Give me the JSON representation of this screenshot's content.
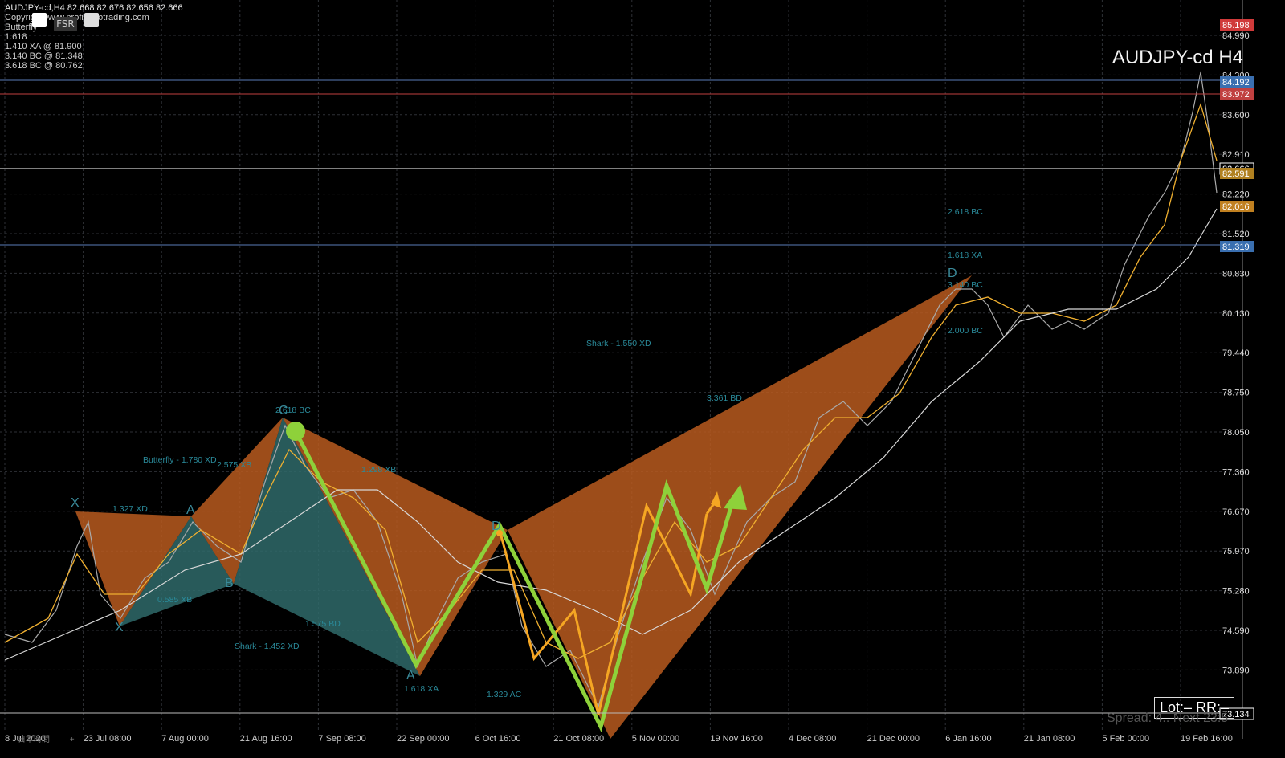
{
  "header": {
    "symbol_line": "AUDJPY-cd,H4  82.668 82.676 82.656 82.666",
    "copyright": "Copyright www.profitzerotrading.com",
    "pattern_name": "Butterfly",
    "levels": [
      "1.618",
      "1.410 XA @ 81.900",
      "3.140 BC @ 81.348",
      "3.618 BC @ 80.762"
    ],
    "toolbar_label": "FSR"
  },
  "chart_title": "AUDJPY-cd H4",
  "lot_label": "Lot:– RR:–",
  "spread_label": "Spread: 4.. Next 23:5",
  "tab_label": "日本時間",
  "tab_add": "+",
  "price_axis": [
    "84.990",
    "84.300",
    "83.600",
    "82.910",
    "82.220",
    "81.520",
    "80.830",
    "80.130",
    "79.440",
    "78.750",
    "78.050",
    "77.360",
    "76.670",
    "75.970",
    "75.280",
    "74.590",
    "73.890"
  ],
  "price_markers": [
    {
      "value": "85.198",
      "color": "#d03a3a"
    },
    {
      "value": "84.192",
      "color": "#3a6fb0"
    },
    {
      "value": "83.972",
      "color": "#c04040"
    },
    {
      "value": "82.666",
      "color": "#ffffff"
    },
    {
      "value": "82.591",
      "color": "#b08020"
    },
    {
      "value": "82.016",
      "color": "#c08020"
    },
    {
      "value": "81.319",
      "color": "#3a6fb0"
    },
    {
      "value": "73.134",
      "color": "#ffffff"
    }
  ],
  "time_axis": [
    "8 Jul 2020",
    "23 Jul 08:00",
    "7 Aug 00:00",
    "21 Aug 16:00",
    "7 Sep 08:00",
    "22 Sep 00:00",
    "6 Oct 16:00",
    "21 Oct 08:00",
    "5 Nov 00:00",
    "19 Nov 16:00",
    "4 Dec 08:00",
    "21 Dec 00:00",
    "6 Jan 16:00",
    "21 Jan 08:00",
    "5 Feb 00:00",
    "19 Feb 16:00"
  ],
  "annotations": [
    "Butterfly - 1.780 XD",
    "2.575 XB",
    "1.327 XD",
    "0.585 XB",
    "1.575 BD",
    "Shark - 1.452 XD",
    "2.618 BC",
    "1.298 XB",
    "1.618 XA",
    "1.329 AC",
    "Shark - 1.550 XD",
    "3.361 BD",
    "2.618 BC",
    "1.618 XA",
    "2.000 BC",
    "3.140 BC"
  ],
  "point_labels": [
    "X",
    "A",
    "B",
    "C",
    "D",
    "X",
    "A",
    "D"
  ],
  "colors": {
    "harmonic_fill": "#b85a1e",
    "teal_fill": "#2f6a6a",
    "green_line": "#8ed13a",
    "orange_line": "#f5a623",
    "grid": "#33363c",
    "candle": "#9a9a9a"
  }
}
